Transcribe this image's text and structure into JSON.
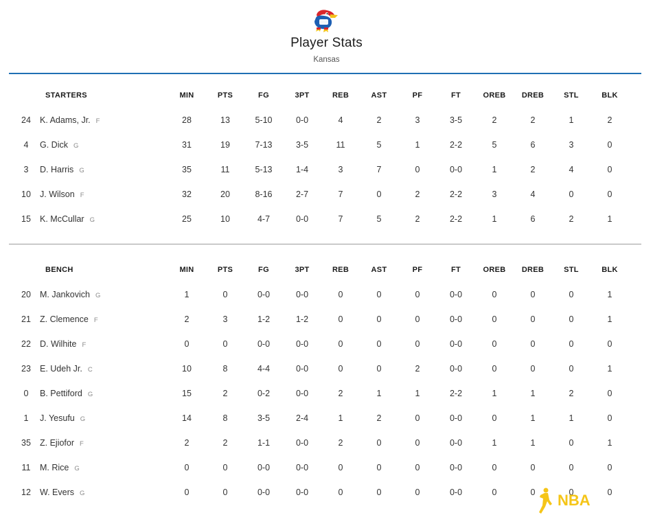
{
  "header": {
    "title": "Player Stats",
    "team": "Kansas"
  },
  "columns": [
    "MIN",
    "PTS",
    "FG",
    "3PT",
    "REB",
    "AST",
    "PF",
    "FT",
    "OREB",
    "DREB",
    "STL",
    "BLK"
  ],
  "starters": {
    "title": "STARTERS",
    "players": [
      {
        "num": "24",
        "name": "K. Adams, Jr.",
        "pos": "F",
        "stats": [
          "28",
          "13",
          "5-10",
          "0-0",
          "4",
          "2",
          "3",
          "3-5",
          "2",
          "2",
          "1",
          "2"
        ]
      },
      {
        "num": "4",
        "name": "G. Dick",
        "pos": "G",
        "stats": [
          "31",
          "19",
          "7-13",
          "3-5",
          "11",
          "5",
          "1",
          "2-2",
          "5",
          "6",
          "3",
          "0"
        ]
      },
      {
        "num": "3",
        "name": "D. Harris",
        "pos": "G",
        "stats": [
          "35",
          "11",
          "5-13",
          "1-4",
          "3",
          "7",
          "0",
          "0-0",
          "1",
          "2",
          "4",
          "0"
        ]
      },
      {
        "num": "10",
        "name": "J. Wilson",
        "pos": "F",
        "stats": [
          "32",
          "20",
          "8-16",
          "2-7",
          "7",
          "0",
          "2",
          "2-2",
          "3",
          "4",
          "0",
          "0"
        ]
      },
      {
        "num": "15",
        "name": "K. McCullar",
        "pos": "G",
        "stats": [
          "25",
          "10",
          "4-7",
          "0-0",
          "7",
          "5",
          "2",
          "2-2",
          "1",
          "6",
          "2",
          "1"
        ]
      }
    ]
  },
  "bench": {
    "title": "BENCH",
    "players": [
      {
        "num": "20",
        "name": "M. Jankovich",
        "pos": "G",
        "stats": [
          "1",
          "0",
          "0-0",
          "0-0",
          "0",
          "0",
          "0",
          "0-0",
          "0",
          "0",
          "0",
          "1"
        ]
      },
      {
        "num": "21",
        "name": "Z. Clemence",
        "pos": "F",
        "stats": [
          "2",
          "3",
          "1-2",
          "1-2",
          "0",
          "0",
          "0",
          "0-0",
          "0",
          "0",
          "0",
          "1"
        ]
      },
      {
        "num": "22",
        "name": "D. Wilhite",
        "pos": "F",
        "stats": [
          "0",
          "0",
          "0-0",
          "0-0",
          "0",
          "0",
          "0",
          "0-0",
          "0",
          "0",
          "0",
          "0"
        ]
      },
      {
        "num": "23",
        "name": "E. Udeh Jr.",
        "pos": "C",
        "stats": [
          "10",
          "8",
          "4-4",
          "0-0",
          "0",
          "0",
          "2",
          "0-0",
          "0",
          "0",
          "0",
          "1"
        ]
      },
      {
        "num": "0",
        "name": "B. Pettiford",
        "pos": "G",
        "stats": [
          "15",
          "2",
          "0-2",
          "0-0",
          "2",
          "1",
          "1",
          "2-2",
          "1",
          "1",
          "2",
          "0"
        ]
      },
      {
        "num": "1",
        "name": "J. Yesufu",
        "pos": "G",
        "stats": [
          "14",
          "8",
          "3-5",
          "2-4",
          "1",
          "2",
          "0",
          "0-0",
          "0",
          "1",
          "1",
          "0"
        ]
      },
      {
        "num": "35",
        "name": "Z. Ejiofor",
        "pos": "F",
        "stats": [
          "2",
          "2",
          "1-1",
          "0-0",
          "2",
          "0",
          "0",
          "0-0",
          "1",
          "1",
          "0",
          "1"
        ]
      },
      {
        "num": "11",
        "name": "M. Rice",
        "pos": "G",
        "stats": [
          "0",
          "0",
          "0-0",
          "0-0",
          "0",
          "0",
          "0",
          "0-0",
          "0",
          "0",
          "0",
          "0"
        ]
      },
      {
        "num": "12",
        "name": "W. Evers",
        "pos": "G",
        "stats": [
          "0",
          "0",
          "0-0",
          "0-0",
          "0",
          "0",
          "0",
          "0-0",
          "0",
          "0",
          "0",
          "0"
        ]
      }
    ]
  },
  "watermark": {
    "text": "NBA",
    "color": "#f5c518"
  },
  "colors": {
    "accent_rule": "#1f6fb3",
    "divider": "#9a9a9a",
    "logo_red": "#d9262c",
    "logo_blue": "#1d5fb3",
    "logo_yellow": "#f4c21a"
  }
}
